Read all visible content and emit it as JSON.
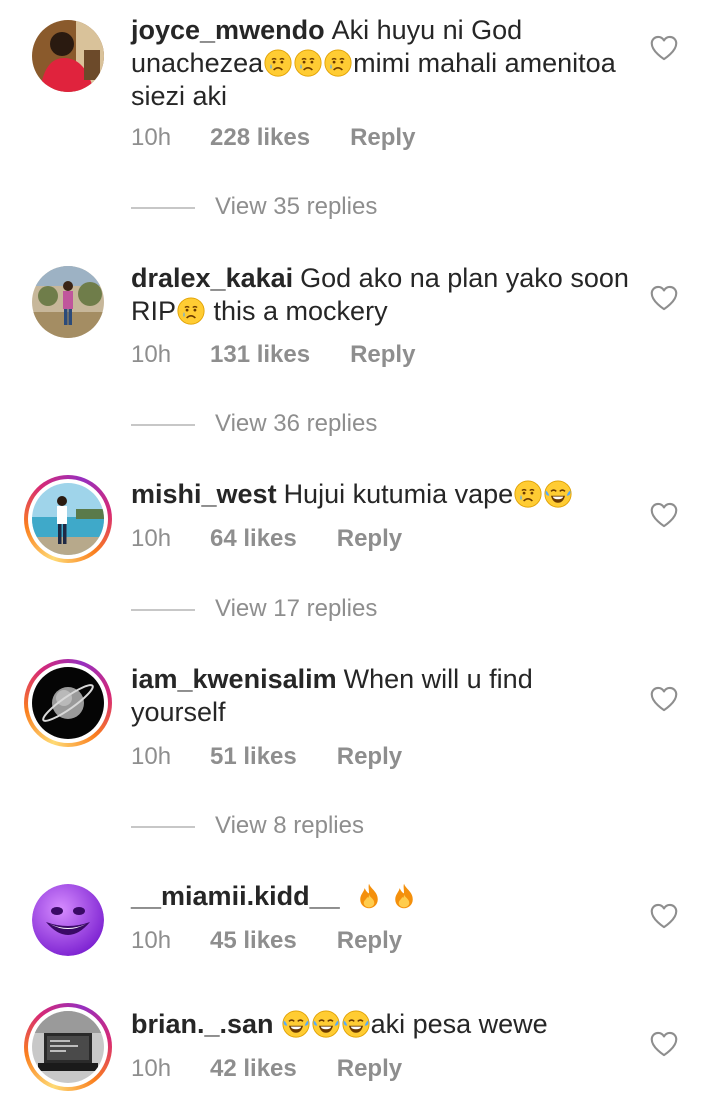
{
  "comments": [
    {
      "username": "joyce_mwendo",
      "segments": [
        "Aki huyu ni God unachezea",
        "mimi mahali amenitoa siezi aki"
      ],
      "time": "10h",
      "likes": "228 likes",
      "reply": "Reply",
      "view_replies": "View 35 replies",
      "avatar": "red-shirt-avatar",
      "emojis": [
        "sad-tear-emoji",
        "sad-tear-emoji",
        "sad-tear-emoji"
      ]
    },
    {
      "username": "dralex_kakai",
      "segments": [
        "God ako na plan yako soon RIP",
        " this a mockery"
      ],
      "time": "10h",
      "likes": "131 likes",
      "reply": "Reply",
      "view_replies": "View 36 replies",
      "avatar": "outdoor-person-avatar",
      "emojis": [
        "sad-tear-emoji"
      ]
    },
    {
      "username": "mishi_west",
      "segments": [
        "Hujui kutumia vape",
        ""
      ],
      "time": "10h",
      "likes": "64 likes",
      "reply": "Reply",
      "view_replies": "View 17 replies",
      "avatar": "beach-avatar",
      "emojis": [
        "sad-tear-emoji",
        "laughing-tears-emoji"
      ]
    },
    {
      "username": "iam_kwenisalim",
      "segments": [
        "When will u find yourself"
      ],
      "time": "10h",
      "likes": "51 likes",
      "reply": "Reply",
      "view_replies": "View 8 replies",
      "avatar": "planet-avatar",
      "emojis": []
    },
    {
      "username": "__miamii.kidd__",
      "segments": [
        ""
      ],
      "time": "10h",
      "likes": "45 likes",
      "reply": "Reply",
      "avatar": "purple-smiley-avatar",
      "emojis": [
        "fire-emoji",
        "fire-emoji"
      ]
    },
    {
      "username": "brian._.san",
      "segments": [
        "",
        "aki pesa wewe"
      ],
      "time": "10h",
      "likes": "42 likes",
      "reply": "Reply",
      "avatar": "laptop-avatar",
      "emojis": [
        "laughing-tears-emoji",
        "laughing-tears-emoji",
        "laughing-tears-emoji"
      ]
    }
  ],
  "icons": {
    "like": "heart-outline-icon"
  },
  "colors": {
    "muted": "#8e8e8e",
    "text": "#262626",
    "story_ring": "#d62976"
  }
}
